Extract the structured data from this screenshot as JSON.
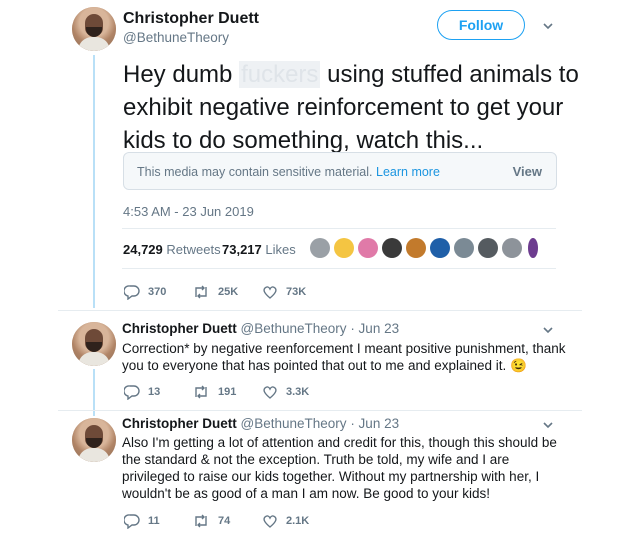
{
  "main_tweet": {
    "author_name": "Christopher Duett",
    "author_handle": "@BethuneTheory",
    "follow_label": "Follow",
    "text_part1": "Hey dumb ",
    "text_censored": "fuckers",
    "text_part2": " using stuffed animals to exhibit negative reinforcement to get your kids to do something, watch this...",
    "sensitive_message": "This media may contain sensitive material.",
    "learn_more_label": "Learn more",
    "view_label": "View",
    "timestamp": "4:53 AM - 23 Jun 2019",
    "retweets_count": "24,729",
    "retweets_label": "Retweets",
    "likes_count": "73,217",
    "likes_label": "Likes",
    "reply_count": "370",
    "retweet_action_count": "25K",
    "like_action_count": "73K"
  },
  "replies": [
    {
      "author_name": "Christopher Duett",
      "author_handle": "@BethuneTheory",
      "date": "· Jun 23",
      "text": "Correction* by negative reenforcement I meant positive punishment, thank you to everyone that has pointed that out to me and explained it. 😉",
      "reply_count": "13",
      "retweet_count": "191",
      "like_count": "3.3K"
    },
    {
      "author_name": "Christopher Duett",
      "author_handle": "@BethuneTheory",
      "date": "· Jun 23",
      "text": "Also I'm getting a lot of attention and credit for this, though this should be the standard & not the exception. Truth be told, my wife and I are privileged to raise our kids together. Without my partnership with her, I wouldn't be as good of a man I am now. Be good to your kids!",
      "reply_count": "11",
      "retweet_count": "74",
      "like_count": "2.1K"
    }
  ],
  "colors": {
    "accent": "#1da1f2",
    "muted": "#657786",
    "thread_line": "#b9e0f7"
  }
}
